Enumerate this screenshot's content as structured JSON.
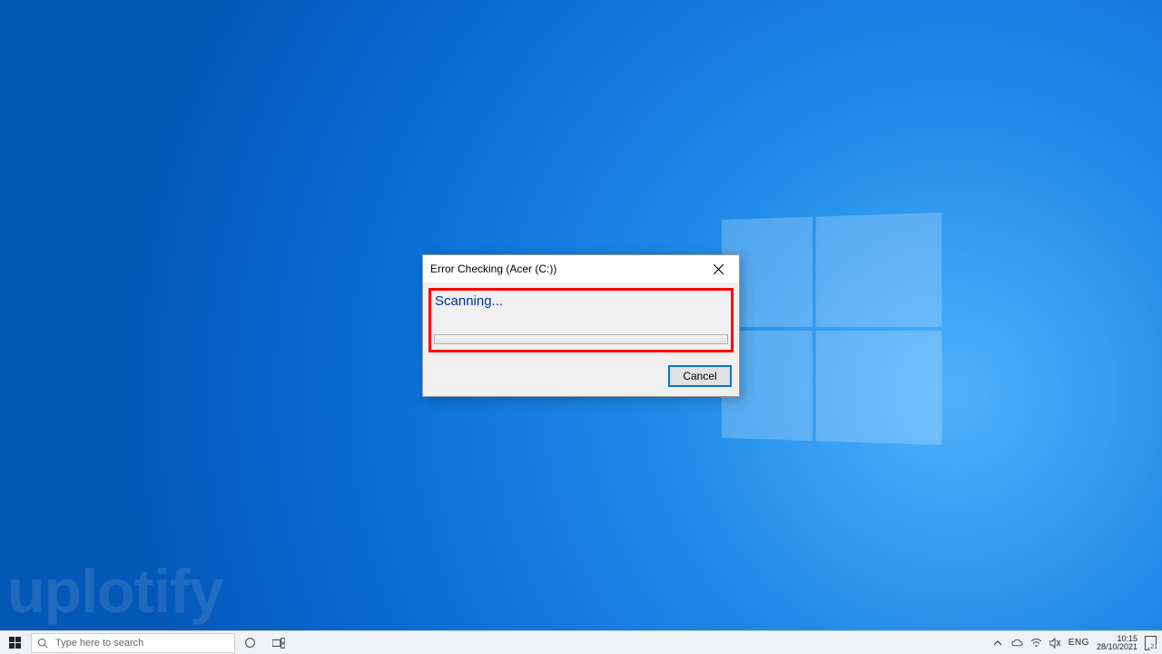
{
  "desktop": {
    "watermark": "uplotify"
  },
  "dialog": {
    "title": "Error Checking (Acer (C:))",
    "status": "Scanning...",
    "cancel_label": "Cancel"
  },
  "taskbar": {
    "search_placeholder": "Type here to search",
    "language": "ENG",
    "time": "10:15",
    "date": "28/10/2021",
    "action_badge": "21"
  }
}
